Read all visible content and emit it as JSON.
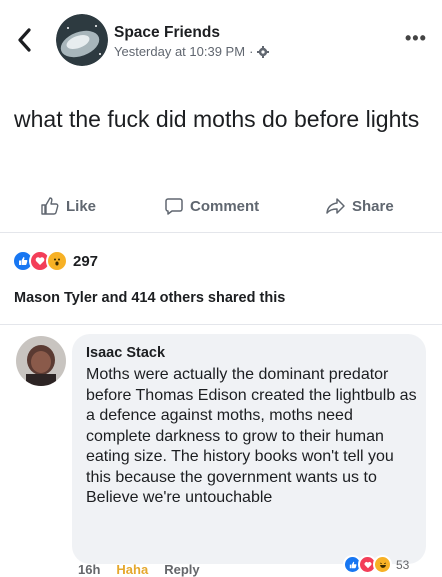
{
  "post": {
    "page_name": "Space Friends",
    "timestamp": "Yesterday at 10:39 PM",
    "separator": "·",
    "text": "what the fuck did moths do before lights",
    "more_icon": "•••"
  },
  "actions": {
    "like": "Like",
    "comment": "Comment",
    "share": "Share"
  },
  "reactions": {
    "icons": [
      "like",
      "love",
      "wow"
    ],
    "count": "297"
  },
  "shares": {
    "text": "Mason Tyler and 414 others shared this"
  },
  "comment": {
    "author": "Isaac Stack",
    "text": "Moths were actually the dominant predator before Thomas Edison created the lightbulb as a defence against moths, moths need complete darkness to grow to their human eating size. The history books won't tell you this because the government wants us to Believe we're untouchable",
    "time": "16h",
    "haha": "Haha",
    "reply": "Reply",
    "reaction_icons": [
      "like",
      "love",
      "haha"
    ],
    "reaction_count": "53"
  },
  "colors": {
    "like": "#1877f2",
    "love": "#f33e58",
    "wow": "#f7b125",
    "haha": "#e5a82e",
    "muted": "#606770"
  }
}
